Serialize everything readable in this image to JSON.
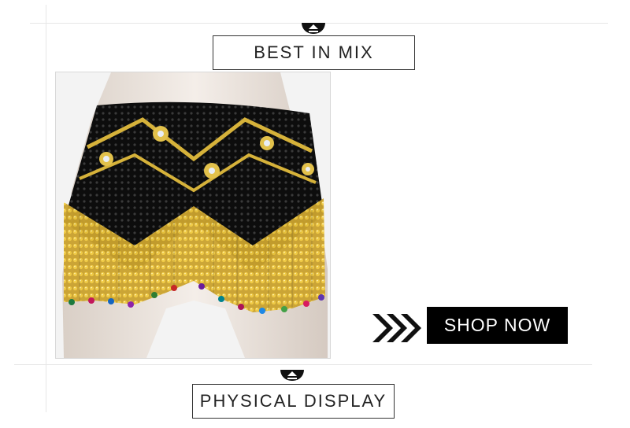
{
  "sections": {
    "top": {
      "title": "BEST IN MIX"
    },
    "bottom": {
      "title": "PHYSICAL DISPLAY"
    }
  },
  "product": {
    "image": "beaded-hip-scarf-product-photo",
    "cta_label": "SHOP NOW"
  },
  "icons": {
    "section_badge": "eject-triangle-icon",
    "cta_arrows": "triple-chevron-right-icon"
  },
  "colors": {
    "accent_dark": "#000000",
    "border": "#333333",
    "divider": "#e6e6e6"
  }
}
